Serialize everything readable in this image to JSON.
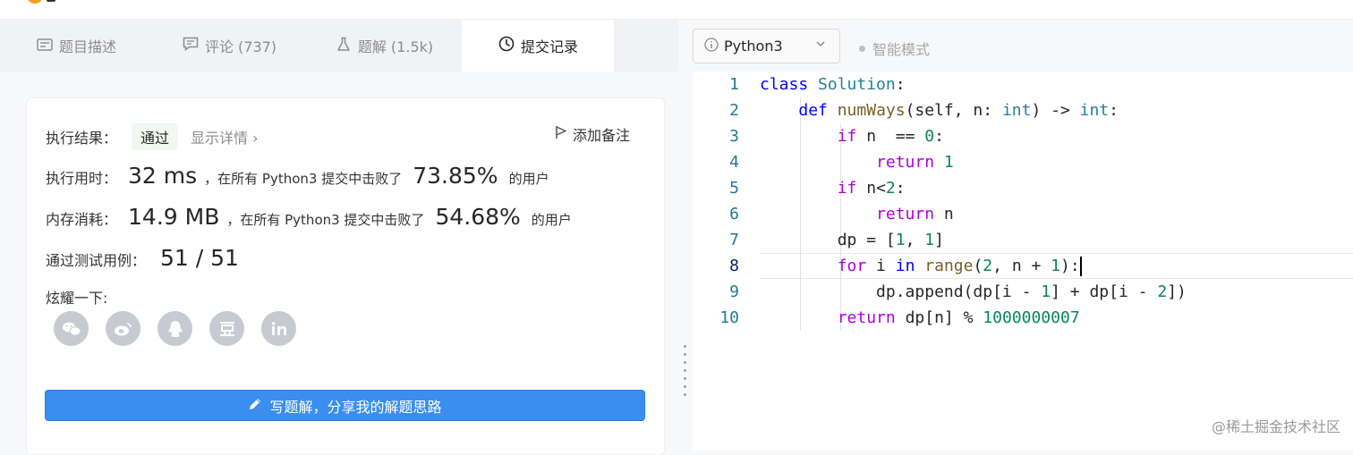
{
  "tabs": [
    {
      "icon": "description-icon",
      "label": "题目描述"
    },
    {
      "icon": "comment-icon",
      "label": "评论 (737)"
    },
    {
      "icon": "flask-icon",
      "label": "题解 (1.5k)"
    },
    {
      "icon": "clock-icon",
      "label": "提交记录"
    }
  ],
  "result": {
    "status_label": "执行结果：",
    "status_value": "通过",
    "detail_link": "显示详情 ›",
    "add_note": "添加备注",
    "time_label": "执行用时：",
    "time_value": "32 ms",
    "time_mid": "，在所有 Python3 提交中击败了",
    "time_pct": "73.85%",
    "time_suffix": "的用户",
    "mem_label": "内存消耗：",
    "mem_value": "14.9 MB",
    "mem_mid": "，在所有 Python3 提交中击败了",
    "mem_pct": "54.68%",
    "mem_suffix": "的用户",
    "tests_label": "通过测试用例：",
    "tests_value": "51 / 51",
    "share_label": "炫耀一下:",
    "share_icons": [
      "wechat-icon",
      "weibo-icon",
      "qq-icon",
      "douban-icon",
      "linkedin-icon"
    ],
    "write_button": "写题解，分享我的解题思路"
  },
  "editor": {
    "language": "Python3",
    "smart_mode": "智能模式",
    "line_numbers": [
      "1",
      "2",
      "3",
      "4",
      "5",
      "6",
      "7",
      "8",
      "9",
      "10"
    ],
    "current_line": 8
  },
  "watermark": "@稀土掘金技术社区",
  "colors": {
    "accent": "#3a8ef0",
    "keyword": "#0000ff",
    "control": "#af00db",
    "class": "#267f99",
    "number": "#098658"
  }
}
